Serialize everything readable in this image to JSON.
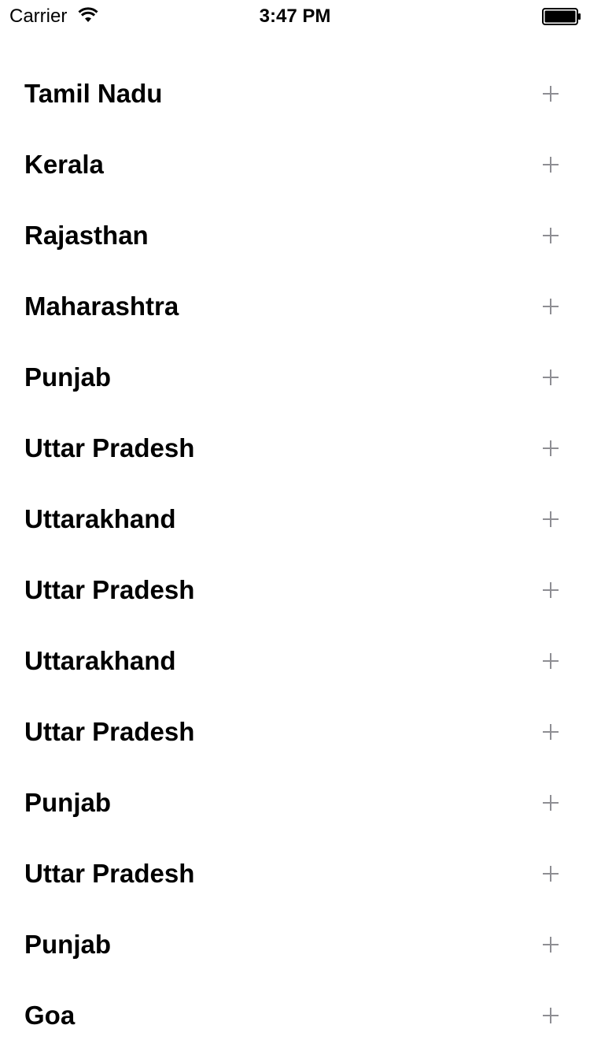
{
  "status_bar": {
    "carrier": "Carrier",
    "time": "3:47 PM",
    "wifi_icon": "wifi-icon",
    "battery_icon": "battery-icon"
  },
  "list": {
    "expand_icon": "plus-icon",
    "items": [
      {
        "label": "Tamil Nadu"
      },
      {
        "label": "Kerala"
      },
      {
        "label": "Rajasthan"
      },
      {
        "label": "Maharashtra"
      },
      {
        "label": "Punjab"
      },
      {
        "label": "Uttar Pradesh"
      },
      {
        "label": "Uttarakhand"
      },
      {
        "label": "Uttar Pradesh"
      },
      {
        "label": "Uttarakhand"
      },
      {
        "label": "Uttar Pradesh"
      },
      {
        "label": "Punjab"
      },
      {
        "label": "Uttar Pradesh"
      },
      {
        "label": "Punjab"
      },
      {
        "label": "Goa"
      }
    ]
  },
  "colors": {
    "background": "#ffffff",
    "text": "#000000",
    "plus_icon": "#8e8e93"
  }
}
